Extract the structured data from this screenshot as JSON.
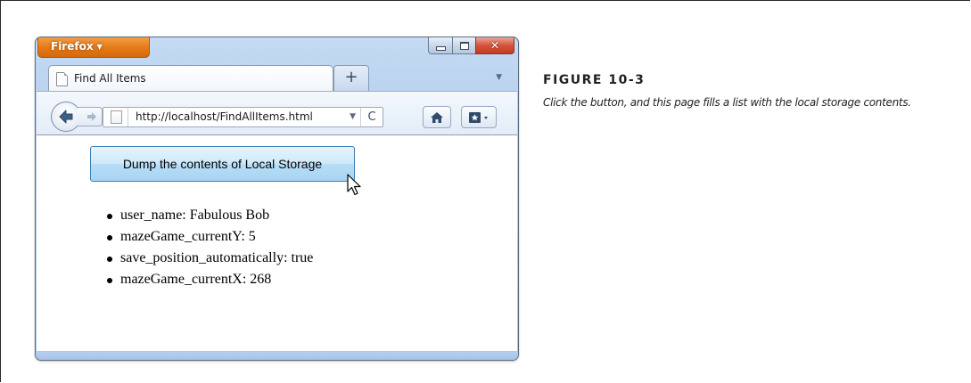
{
  "browser": {
    "menu_button_label": "Firefox",
    "tab": {
      "title": "Find All Items"
    },
    "new_tab_label": "+",
    "url": "http://localhost/FindAllItems.html"
  },
  "page": {
    "button_label": "Dump the contents of Local Storage",
    "storage_items": [
      "user_name: Fabulous Bob",
      "mazeGame_currentY: 5",
      "save_position_automatically: true",
      "mazeGame_currentX: 268"
    ]
  },
  "figure": {
    "title": "FIGURE 10-3",
    "caption": "Click the button, and this page fills a list with the local storage contents."
  },
  "colors": {
    "firefox_orange": "#e57a17",
    "window_frame": "#b9d2ef",
    "button_blue": "#b7ddf6",
    "close_red": "#d5533c"
  }
}
